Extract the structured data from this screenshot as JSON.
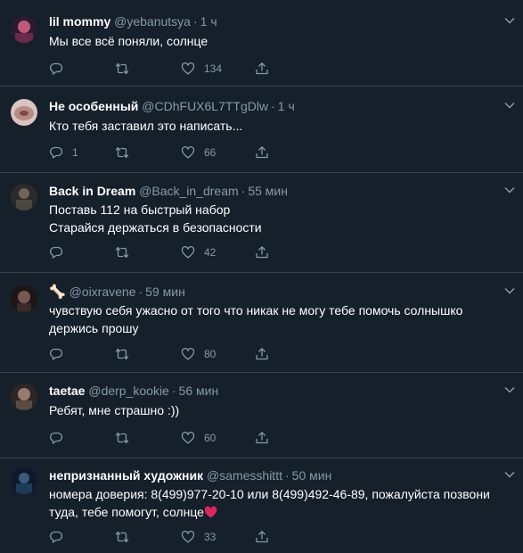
{
  "tweets": [
    {
      "name": "lil mommy",
      "handle": "@yebanutsya",
      "time": "1 ч",
      "lines": [
        "Мы все всё поняли, солнце"
      ],
      "replies": "",
      "likes": "134",
      "avatar_color": "#6a2a4a"
    },
    {
      "name": "Не особенный",
      "handle": "@CDhFUX6L7TTgDlw",
      "time": "1 ч",
      "lines": [
        "Кто тебя заставил это написать..."
      ],
      "replies": "1",
      "likes": "66",
      "avatar_color": "#b88a84"
    },
    {
      "name": "Back in Dream",
      "handle": "@Back_in_dream",
      "time": "55 мин",
      "lines": [
        "Поставь 112 на быстрый набор",
        "Старайся держаться в безопасности"
      ],
      "replies": "",
      "likes": "42",
      "avatar_color": "#4a4640"
    },
    {
      "name": "🦴",
      "handle": "@oixravene",
      "time": "59 мин",
      "lines": [
        "чувствую себя ужасно от того что никак не могу тебе помочь солнышко",
        "держись прошу"
      ],
      "replies": "",
      "likes": "80",
      "avatar_color": "#3a2c2a"
    },
    {
      "name": "taetae",
      "handle": "@derp_kookie",
      "time": "56 мин",
      "lines": [
        "Ребят, мне страшно :))"
      ],
      "replies": "",
      "likes": "60",
      "avatar_color": "#5a4a44"
    },
    {
      "name": "непризнанный художник",
      "handle": "@samesshittt",
      "time": "50 мин",
      "lines": [
        "номера доверия: 8(499)977-20-10 или 8(499)492-46-89, пожалуйста позвони",
        "туда, тебе помогут, солнце"
      ],
      "replies": "",
      "likes": "33",
      "avatar_color": "#1e3a5a"
    }
  ],
  "separator": "·",
  "heart_color": "#e0245e",
  "icon_color": "#8899a6",
  "background": "#15202b"
}
